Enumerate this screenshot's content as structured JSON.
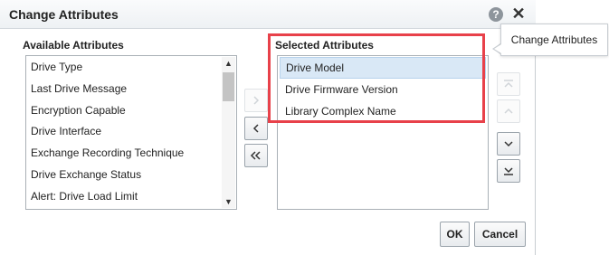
{
  "dialog": {
    "title": "Change Attributes",
    "help_icon": "help-icon",
    "close_icon": "close-icon"
  },
  "available": {
    "label": "Available Attributes",
    "items": [
      "Drive Type",
      "Last Drive Message",
      "Encryption Capable",
      "Drive Interface",
      "Exchange Recording Technique",
      "Drive Exchange Status",
      "Alert: Drive Load Limit"
    ]
  },
  "selected": {
    "label": "Selected Attributes",
    "items": [
      "Drive Model",
      "Drive Firmware Version",
      "Library Complex Name"
    ],
    "active_index": 0
  },
  "tooltip": {
    "text": "Change Attributes"
  },
  "buttons": {
    "ok": "OK",
    "cancel": "Cancel"
  },
  "colors": {
    "highlight": "#e8414a",
    "selection": "#d9e8f6"
  }
}
